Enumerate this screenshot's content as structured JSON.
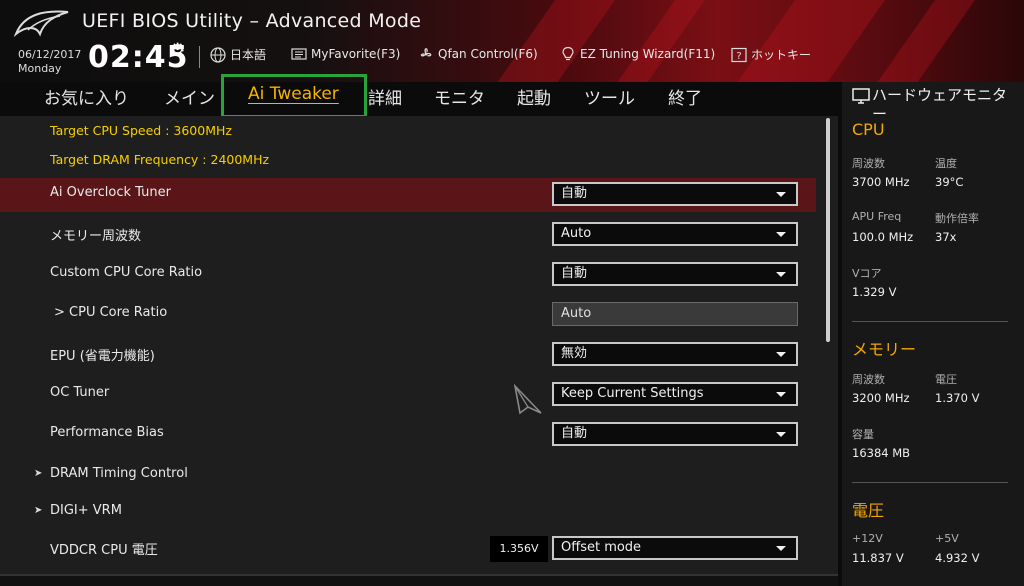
{
  "header": {
    "title": "UEFI BIOS Utility – Advanced Mode",
    "date": "06/12/2017",
    "weekday": "Monday",
    "time": "02:45",
    "buttons": [
      {
        "label": "日本語",
        "icon": "globe-icon"
      },
      {
        "label": "MyFavorite(F3)",
        "icon": "favorite-list-icon"
      },
      {
        "label": "Qfan Control(F6)",
        "icon": "fan-icon"
      },
      {
        "label": "EZ Tuning Wizard(F11)",
        "icon": "lightbulb-icon"
      },
      {
        "label": "ホットキー",
        "icon": "question-box-icon"
      }
    ]
  },
  "tabs": [
    "お気に入り",
    "メイン",
    "Ai Tweaker",
    "詳細",
    "モニタ",
    "起動",
    "ツール",
    "終了"
  ],
  "active_tab": "Ai Tweaker",
  "main": {
    "target_cpu": "Target CPU Speed : 3600MHz",
    "target_dram": "Target DRAM Frequency : 2400MHz",
    "rows": [
      {
        "label": "Ai Overclock Tuner",
        "value": "自動"
      },
      {
        "label": "メモリー周波数",
        "value": "Auto"
      },
      {
        "label": "Custom CPU Core Ratio",
        "value": "自動"
      },
      {
        "label": "> CPU Core Ratio",
        "value": "Auto"
      },
      {
        "label": "EPU (省電力機能)",
        "value": "無効"
      },
      {
        "label": "OC Tuner",
        "value": "Keep Current Settings"
      },
      {
        "label": "Performance Bias",
        "value": "自動"
      },
      {
        "label": "DRAM Timing Control"
      },
      {
        "label": "DIGI+ VRM"
      },
      {
        "label": "VDDCR CPU 電圧",
        "value": "Offset mode",
        "reading": "1.356V"
      }
    ]
  },
  "hw_monitor": {
    "title": "ハードウェアモニター",
    "cpu": {
      "title": "CPU",
      "freq_label": "周波数",
      "freq": "3700 MHz",
      "temp_label": "温度",
      "temp": "39°C",
      "apu_label": "APU Freq",
      "apu": "100.0 MHz",
      "ratio_label": "動作倍率",
      "ratio": "37x",
      "vcore_label": "Vコア",
      "vcore": "1.329 V"
    },
    "memory": {
      "title": "メモリー",
      "freq_label": "周波数",
      "freq": "3200 MHz",
      "volt_label": "電圧",
      "volt": "1.370 V",
      "cap_label": "容量",
      "cap": "16384 MB"
    },
    "voltage": {
      "title": "電圧",
      "v12_label": "+12V",
      "v12": "11.837 V",
      "v5_label": "+5V",
      "v5": "4.932 V"
    }
  },
  "colors": {
    "accent": "#f5a500",
    "selected_row": "#5a1519",
    "highlight_box": "#2aa33a",
    "info_text": "#f5d000"
  }
}
